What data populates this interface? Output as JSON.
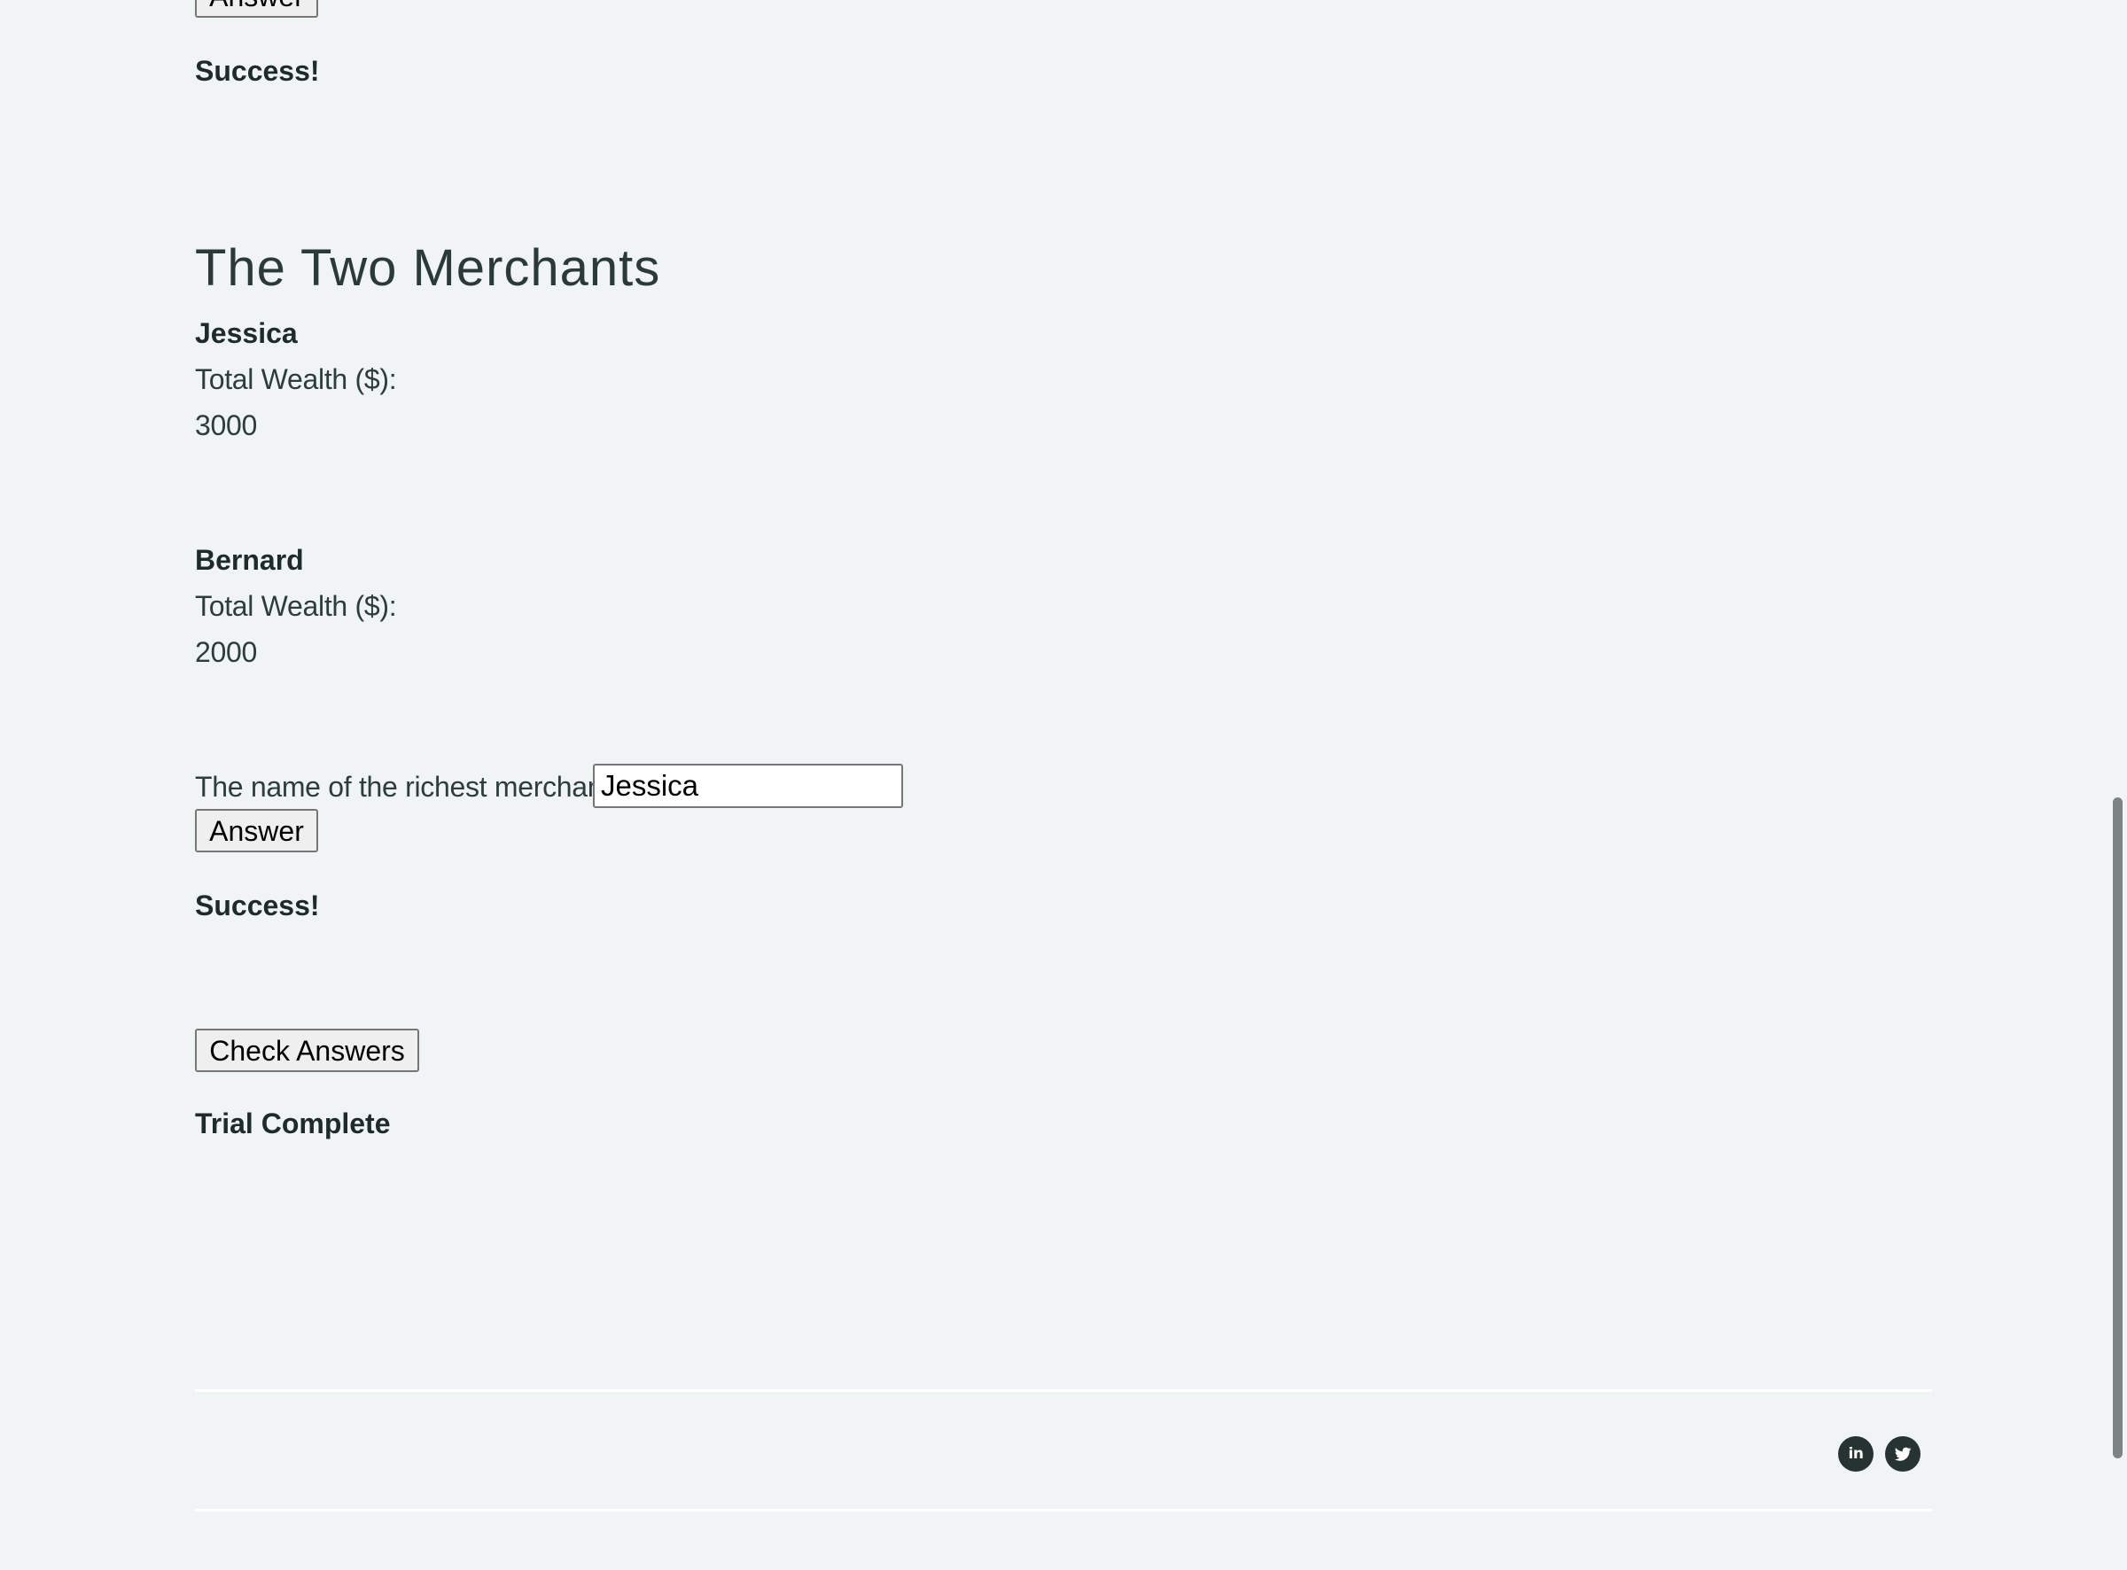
{
  "previous_section": {
    "answer_button_label": "Answer",
    "result_text": "Success!"
  },
  "puzzle": {
    "title": "The Two Merchants",
    "merchants": [
      {
        "name": "Jessica",
        "wealth_label": "Total Wealth ($):",
        "wealth_value": "3000"
      },
      {
        "name": "Bernard",
        "wealth_label": "Total Wealth ($):",
        "wealth_value": "2000"
      }
    ],
    "question_label": "The name of the richest merchant:",
    "answer_value": "Jessica",
    "answer_button_label": "Answer",
    "result_text": "Success!"
  },
  "check": {
    "button_label": "Check Answers",
    "status_text": "Trial Complete"
  },
  "footer": {
    "social_icons": [
      "linkedin-icon",
      "twitter-icon"
    ]
  }
}
